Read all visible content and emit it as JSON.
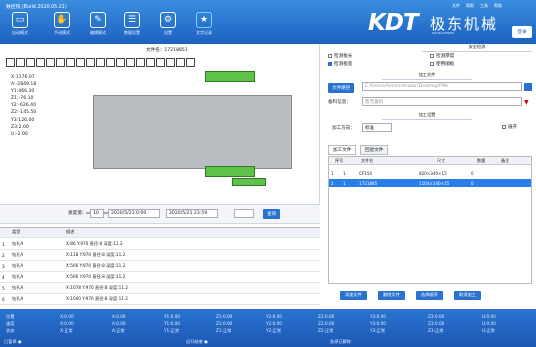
{
  "app": {
    "title": "数控铣 (Build 2020.05.21)",
    "menu": [
      "文件",
      "帮助",
      "工具",
      "帮助"
    ],
    "login": "登录"
  },
  "toolbar": [
    {
      "label": "自动模式",
      "icon": "monitor-icon"
    },
    {
      "label": "手动模式",
      "icon": "hand-icon"
    },
    {
      "label": "编辑模式",
      "icon": "edit-icon"
    },
    {
      "label": "数据设置",
      "icon": "list-icon"
    },
    {
      "label": "设置",
      "icon": "gear-icon"
    },
    {
      "label": "文字记录",
      "icon": "star-icon"
    }
  ],
  "brand": {
    "name": "KDT",
    "cn": "极东机械",
    "en": "KDTMACHINERY"
  },
  "file_label": "文件名：17218851",
  "readout": [
    "X:1176.07",
    "A:-2849.18",
    "Y1:466.30",
    "Z1:-76.10",
    "Y2:-626.40",
    "Z2:-145.50",
    "Y3:126.00",
    "Z3:2.00",
    "U:-2.00"
  ],
  "control": {
    "speed_label": "速度值：",
    "speed_value": "10",
    "date_from": "2020/5/21 0:00",
    "date_to": "2020/5/21 23:59",
    "query": "查询"
  },
  "log": {
    "headers": [
      "类型",
      "描述"
    ],
    "rows": [
      [
        "钻孔A",
        "X:86 Y:970 直径:8 深度:11.2"
      ],
      [
        "钻孔A",
        "X:118 Y:970 直径:8 深度:11.2"
      ],
      [
        "钻孔A",
        "X:566 Y:970 直径:8 深度:11.2"
      ],
      [
        "钻孔A",
        "X:566 Y:970 直径:8 深度:11.2"
      ],
      [
        "钻孔A",
        "X:1078 Y:970 直径:8 深度:11.2"
      ],
      [
        "钻孔A",
        "X:1040 Y:970 直径:8 深度:11.2"
      ]
    ]
  },
  "right": {
    "safety_title": "安全检测",
    "checks": [
      "检测板长",
      "检测板宽",
      "检测厚度",
      "使用顺板"
    ],
    "process_title": "加工文件",
    "path_btn": "文件路径",
    "path": "C:/Users/Administrator/Desktop/FMs",
    "note_lbl": "备料信息：",
    "note_ph": "暂无备料",
    "setting_title": "加工设置",
    "dir_lbl": "加工方向：",
    "dir_val": "标准",
    "expand": "展开",
    "tabs": [
      "加工文件",
      "回退文件"
    ],
    "cols": [
      "序号",
      "文件名",
      "尺寸",
      "数量",
      "备注"
    ],
    "files": [
      [
        "1",
        "1",
        "CF154",
        "820×340×15",
        "0"
      ],
      [
        "2",
        "1",
        "1721885",
        "1164×340×15",
        "0"
      ]
    ],
    "buttons": [
      "添加文件",
      "删除文件",
      "选择顺序",
      "取消加工"
    ]
  },
  "status": {
    "rows": [
      [
        "位置",
        "X:0.00",
        "A:0.00",
        "Y1:0.00",
        "Z1:0.00",
        "Y2:0.00",
        "Z2:0.00",
        "Y3:0.00",
        "Z3:0.00",
        "U:0.00"
      ],
      [
        "速度",
        "X:0.00",
        "A:0.00",
        "Y1:0.00",
        "Z1:0.00",
        "Y2:0.00",
        "Z2:0.00",
        "Y3:0.00",
        "Z3:0.00",
        "U:0.00"
      ],
      [
        "状态",
        "X:正常",
        "A:正常",
        "Y1:正常",
        "Z1:正常",
        "Y2:正常",
        "Z2:正常",
        "Y3:正常",
        "Z3:正常",
        "U:正常"
      ]
    ],
    "footer": [
      "已暂停 ●",
      "运行结束 ●",
      "急停已解除"
    ]
  }
}
